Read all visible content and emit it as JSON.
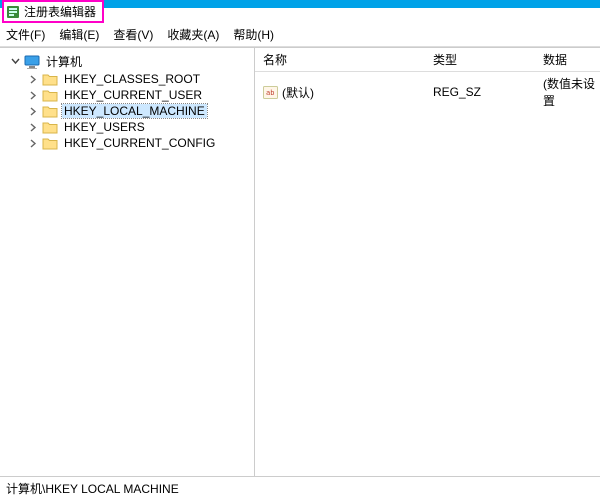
{
  "window": {
    "title": "注册表编辑器"
  },
  "menu": {
    "file": "文件(F)",
    "edit": "编辑(E)",
    "view": "查看(V)",
    "favorites": "收藏夹(A)",
    "help": "帮助(H)"
  },
  "tree": {
    "root": "计算机",
    "items": [
      {
        "label": "HKEY_CLASSES_ROOT"
      },
      {
        "label": "HKEY_CURRENT_USER"
      },
      {
        "label": "HKEY_LOCAL_MACHINE"
      },
      {
        "label": "HKEY_USERS"
      },
      {
        "label": "HKEY_CURRENT_CONFIG"
      }
    ],
    "selected_index": 2
  },
  "columns": {
    "name": "名称",
    "type": "类型",
    "data": "数据"
  },
  "rows": [
    {
      "name": "(默认)",
      "type": "REG_SZ",
      "data": "(数值未设置"
    }
  ],
  "status": "计算机\\HKEY LOCAL MACHINE"
}
